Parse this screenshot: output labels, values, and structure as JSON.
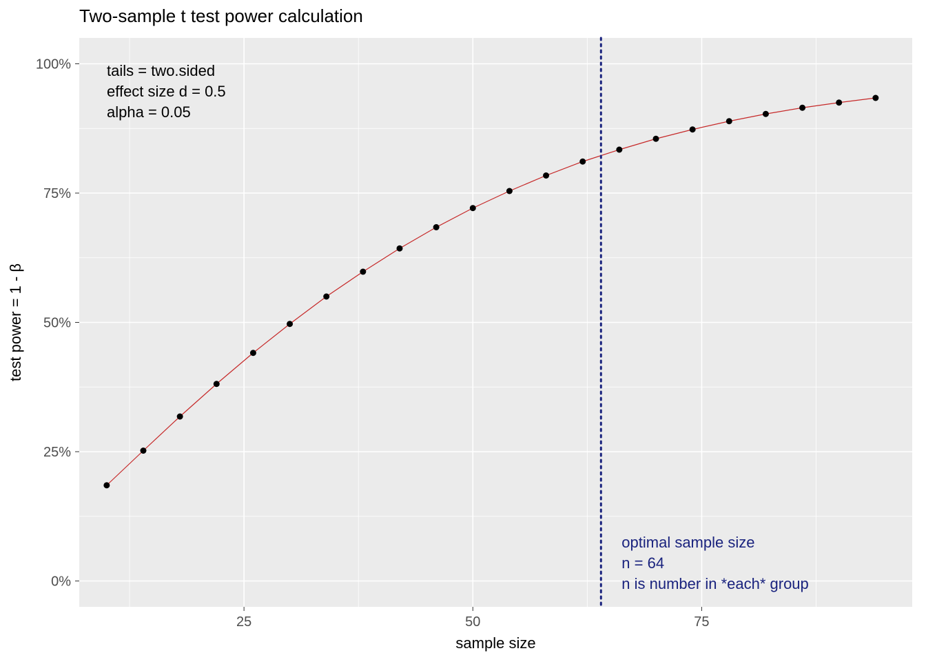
{
  "chart_data": {
    "type": "line",
    "title": "Two-sample t test power calculation",
    "xlabel": "sample size",
    "ylabel": "test power = 1 - β",
    "xlim": [
      7,
      98
    ],
    "ylim": [
      -0.05,
      1.05
    ],
    "x_ticks": [
      25,
      50,
      75
    ],
    "x_tick_labels": [
      "25",
      "50",
      "75"
    ],
    "y_ticks": [
      0,
      0.25,
      0.5,
      0.75,
      1.0
    ],
    "y_tick_labels": [
      "0%",
      "25%",
      "50%",
      "75%",
      "100%"
    ],
    "x": [
      10,
      14,
      18,
      22,
      26,
      30,
      34,
      38,
      42,
      46,
      50,
      54,
      58,
      62,
      66,
      70,
      74,
      78,
      82,
      86,
      90,
      94
    ],
    "values": [
      0.185,
      0.252,
      0.318,
      0.381,
      0.441,
      0.497,
      0.55,
      0.598,
      0.643,
      0.684,
      0.721,
      0.754,
      0.784,
      0.811,
      0.834,
      0.855,
      0.873,
      0.889,
      0.903,
      0.915,
      0.925,
      0.934
    ],
    "vline": 64,
    "vline_color": "#1a237e",
    "line_color": "#c62828",
    "point_color": "#000000",
    "annotations_left": {
      "line1": "tails = two.sided",
      "line2": "effect size d = 0.5",
      "line3": "alpha = 0.05"
    },
    "annotations_right": {
      "line1": "optimal sample size",
      "line2": "n = 64",
      "line3": "n is number in *each* group"
    }
  }
}
